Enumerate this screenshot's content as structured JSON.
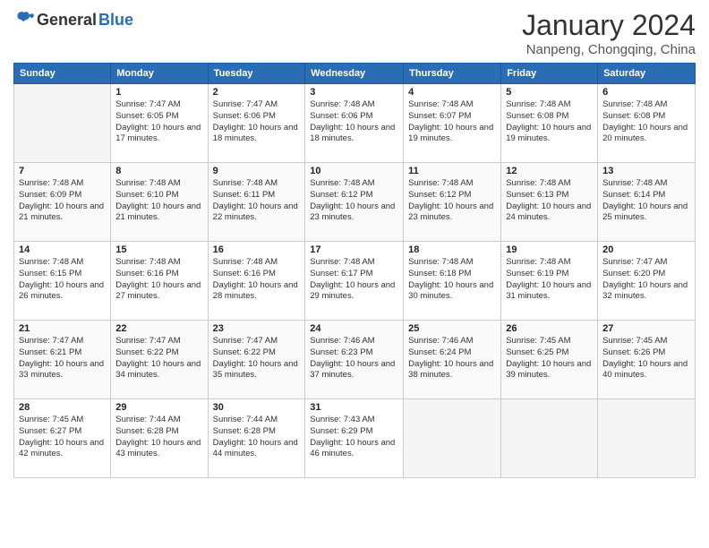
{
  "logo": {
    "general": "General",
    "blue": "Blue"
  },
  "title": "January 2024",
  "location": "Nanpeng, Chongqing, China",
  "weekdays": [
    "Sunday",
    "Monday",
    "Tuesday",
    "Wednesday",
    "Thursday",
    "Friday",
    "Saturday"
  ],
  "weeks": [
    [
      {
        "day": null
      },
      {
        "day": "1",
        "sunrise": "7:47 AM",
        "sunset": "6:05 PM",
        "daylight": "10 hours and 17 minutes."
      },
      {
        "day": "2",
        "sunrise": "7:47 AM",
        "sunset": "6:06 PM",
        "daylight": "10 hours and 18 minutes."
      },
      {
        "day": "3",
        "sunrise": "7:48 AM",
        "sunset": "6:06 PM",
        "daylight": "10 hours and 18 minutes."
      },
      {
        "day": "4",
        "sunrise": "7:48 AM",
        "sunset": "6:07 PM",
        "daylight": "10 hours and 19 minutes."
      },
      {
        "day": "5",
        "sunrise": "7:48 AM",
        "sunset": "6:08 PM",
        "daylight": "10 hours and 19 minutes."
      },
      {
        "day": "6",
        "sunrise": "7:48 AM",
        "sunset": "6:08 PM",
        "daylight": "10 hours and 20 minutes."
      }
    ],
    [
      {
        "day": "7",
        "sunrise": "7:48 AM",
        "sunset": "6:09 PM",
        "daylight": "10 hours and 21 minutes."
      },
      {
        "day": "8",
        "sunrise": "7:48 AM",
        "sunset": "6:10 PM",
        "daylight": "10 hours and 21 minutes."
      },
      {
        "day": "9",
        "sunrise": "7:48 AM",
        "sunset": "6:11 PM",
        "daylight": "10 hours and 22 minutes."
      },
      {
        "day": "10",
        "sunrise": "7:48 AM",
        "sunset": "6:12 PM",
        "daylight": "10 hours and 23 minutes."
      },
      {
        "day": "11",
        "sunrise": "7:48 AM",
        "sunset": "6:12 PM",
        "daylight": "10 hours and 23 minutes."
      },
      {
        "day": "12",
        "sunrise": "7:48 AM",
        "sunset": "6:13 PM",
        "daylight": "10 hours and 24 minutes."
      },
      {
        "day": "13",
        "sunrise": "7:48 AM",
        "sunset": "6:14 PM",
        "daylight": "10 hours and 25 minutes."
      }
    ],
    [
      {
        "day": "14",
        "sunrise": "7:48 AM",
        "sunset": "6:15 PM",
        "daylight": "10 hours and 26 minutes."
      },
      {
        "day": "15",
        "sunrise": "7:48 AM",
        "sunset": "6:16 PM",
        "daylight": "10 hours and 27 minutes."
      },
      {
        "day": "16",
        "sunrise": "7:48 AM",
        "sunset": "6:16 PM",
        "daylight": "10 hours and 28 minutes."
      },
      {
        "day": "17",
        "sunrise": "7:48 AM",
        "sunset": "6:17 PM",
        "daylight": "10 hours and 29 minutes."
      },
      {
        "day": "18",
        "sunrise": "7:48 AM",
        "sunset": "6:18 PM",
        "daylight": "10 hours and 30 minutes."
      },
      {
        "day": "19",
        "sunrise": "7:48 AM",
        "sunset": "6:19 PM",
        "daylight": "10 hours and 31 minutes."
      },
      {
        "day": "20",
        "sunrise": "7:47 AM",
        "sunset": "6:20 PM",
        "daylight": "10 hours and 32 minutes."
      }
    ],
    [
      {
        "day": "21",
        "sunrise": "7:47 AM",
        "sunset": "6:21 PM",
        "daylight": "10 hours and 33 minutes."
      },
      {
        "day": "22",
        "sunrise": "7:47 AM",
        "sunset": "6:22 PM",
        "daylight": "10 hours and 34 minutes."
      },
      {
        "day": "23",
        "sunrise": "7:47 AM",
        "sunset": "6:22 PM",
        "daylight": "10 hours and 35 minutes."
      },
      {
        "day": "24",
        "sunrise": "7:46 AM",
        "sunset": "6:23 PM",
        "daylight": "10 hours and 37 minutes."
      },
      {
        "day": "25",
        "sunrise": "7:46 AM",
        "sunset": "6:24 PM",
        "daylight": "10 hours and 38 minutes."
      },
      {
        "day": "26",
        "sunrise": "7:45 AM",
        "sunset": "6:25 PM",
        "daylight": "10 hours and 39 minutes."
      },
      {
        "day": "27",
        "sunrise": "7:45 AM",
        "sunset": "6:26 PM",
        "daylight": "10 hours and 40 minutes."
      }
    ],
    [
      {
        "day": "28",
        "sunrise": "7:45 AM",
        "sunset": "6:27 PM",
        "daylight": "10 hours and 42 minutes."
      },
      {
        "day": "29",
        "sunrise": "7:44 AM",
        "sunset": "6:28 PM",
        "daylight": "10 hours and 43 minutes."
      },
      {
        "day": "30",
        "sunrise": "7:44 AM",
        "sunset": "6:28 PM",
        "daylight": "10 hours and 44 minutes."
      },
      {
        "day": "31",
        "sunrise": "7:43 AM",
        "sunset": "6:29 PM",
        "daylight": "10 hours and 46 minutes."
      },
      {
        "day": null
      },
      {
        "day": null
      },
      {
        "day": null
      }
    ]
  ],
  "labels": {
    "sunrise_prefix": "Sunrise: ",
    "sunset_prefix": "Sunset: ",
    "daylight_prefix": "Daylight: "
  }
}
